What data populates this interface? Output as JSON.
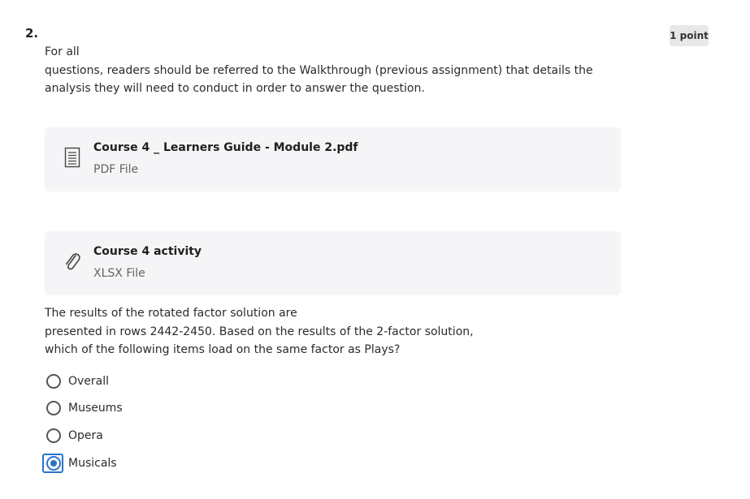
{
  "question": {
    "number": "2.",
    "points": "1 point",
    "intro_lines": [
      "For all",
      "questions, readers should be referred to the Walkthrough (previous assignment) that details the",
      "analysis they will need to conduct in order to answer the question."
    ],
    "prompt_lines": [
      "The results of the rotated factor solution are",
      "presented in rows 2442-2450. Based on the results of the 2-factor solution,",
      "which of the following items load on the same factor as Plays?"
    ]
  },
  "attachments": [
    {
      "title": "Course 4 _ Learners Guide - Module 2.pdf",
      "type": "PDF File",
      "icon": "document-icon"
    },
    {
      "title": "Course 4 activity",
      "type": "XLSX File",
      "icon": "paperclip-icon"
    }
  ],
  "options": [
    {
      "label": "Overall",
      "selected": false
    },
    {
      "label": "Museums",
      "selected": false
    },
    {
      "label": "Opera",
      "selected": false
    },
    {
      "label": "Musicals",
      "selected": true
    }
  ],
  "colors": {
    "accent": "#2a73cc",
    "attachment_bg": "#f5f5f7",
    "points_badge_bg": "#e8e8e8"
  }
}
